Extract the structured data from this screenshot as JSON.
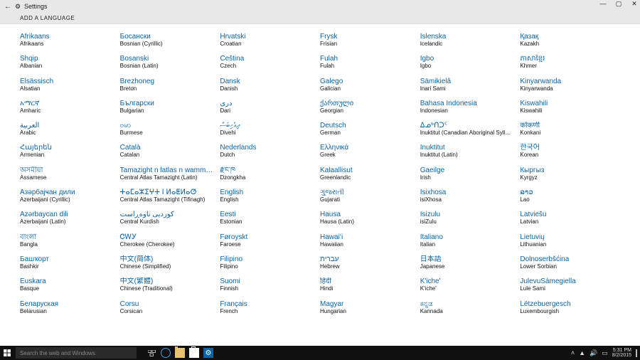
{
  "window": {
    "title": "Settings",
    "page_header": "ADD A LANGUAGE"
  },
  "columns": [
    [
      {
        "native": "Afrikaans",
        "english": "Afrikaans"
      },
      {
        "native": "Shqip",
        "english": "Albanian"
      },
      {
        "native": "Elsässisch",
        "english": "Alsatian"
      },
      {
        "native": "አማርኛ",
        "english": "Amharic"
      },
      {
        "native": "العربية",
        "english": "Arabic"
      },
      {
        "native": "Հայերեն",
        "english": "Armenian"
      },
      {
        "native": "অসমীয়া",
        "english": "Assamese"
      },
      {
        "native": "Азәрбајҹан дили",
        "english": "Azerbaijani (Cyrillic)"
      },
      {
        "native": "Azərbaycan dili",
        "english": "Azerbaijani (Latin)"
      },
      {
        "native": "বাংলা",
        "english": "Bangla"
      },
      {
        "native": "Башҡорт",
        "english": "Bashkir"
      },
      {
        "native": "Euskara",
        "english": "Basque"
      },
      {
        "native": "Беларуская",
        "english": "Belarusian"
      }
    ],
    [
      {
        "native": "Босански",
        "english": "Bosnian (Cyrillic)"
      },
      {
        "native": "Bosanski",
        "english": "Bosnian (Latin)"
      },
      {
        "native": "Brezhoneg",
        "english": "Breton"
      },
      {
        "native": "Български",
        "english": "Bulgarian"
      },
      {
        "native": "ဗမာ",
        "english": "Burmese"
      },
      {
        "native": "Català",
        "english": "Catalan"
      },
      {
        "native": "Tamazight n latlas n wamm…",
        "english": "Central Atlas Tamazight (Latin)"
      },
      {
        "native": "ⵜⴰⵎⴰⵣⵉⵖⵜ ⵏ ⵍⴰⵟⵍⴰⵚ",
        "english": "Central Atlas Tamazight (Tifinagh)"
      },
      {
        "native": "کوردیی ناوەڕاست",
        "english": "Central Kurdish"
      },
      {
        "native": "ᏣᎳᎩ",
        "english": "Cherokee (Cherokee)"
      },
      {
        "native": "中文(简体)",
        "english": "Chinese (Simplified)"
      },
      {
        "native": "中文(繁體)",
        "english": "Chinese (Traditional)"
      },
      {
        "native": "Corsu",
        "english": "Corsican"
      }
    ],
    [
      {
        "native": "Hrvatski",
        "english": "Croatian"
      },
      {
        "native": "Čeština",
        "english": "Czech"
      },
      {
        "native": "Dansk",
        "english": "Danish"
      },
      {
        "native": "درى",
        "english": "Dari"
      },
      {
        "native": "ދިވެހިބަސް",
        "english": "Divehi"
      },
      {
        "native": "Nederlands",
        "english": "Dutch"
      },
      {
        "native": "རྫོང་ཁ",
        "english": "Dzongkha"
      },
      {
        "native": "English",
        "english": "English"
      },
      {
        "native": "Eesti",
        "english": "Estonian"
      },
      {
        "native": "Føroyskt",
        "english": "Faroese"
      },
      {
        "native": "Filipino",
        "english": "Filipino"
      },
      {
        "native": "Suomi",
        "english": "Finnish"
      },
      {
        "native": "Français",
        "english": "French"
      }
    ],
    [
      {
        "native": "Frysk",
        "english": "Frisian"
      },
      {
        "native": "Fulah",
        "english": "Fulah"
      },
      {
        "native": "Galego",
        "english": "Galician"
      },
      {
        "native": "ქართული",
        "english": "Georgian"
      },
      {
        "native": "Deutsch",
        "english": "German"
      },
      {
        "native": "Ελληνικά",
        "english": "Greek"
      },
      {
        "native": "Kalaallisut",
        "english": "Greenlandic"
      },
      {
        "native": "ગુજરાતી",
        "english": "Gujarati"
      },
      {
        "native": "Hausa",
        "english": "Hausa (Latin)"
      },
      {
        "native": "Hawaiʻi",
        "english": "Hawaiian"
      },
      {
        "native": "עברית",
        "english": "Hebrew"
      },
      {
        "native": "हिंदी",
        "english": "Hindi"
      },
      {
        "native": "Magyar",
        "english": "Hungarian"
      }
    ],
    [
      {
        "native": "Íslenska",
        "english": "Icelandic"
      },
      {
        "native": "Igbo",
        "english": "Igbo"
      },
      {
        "native": "Sämikielâ",
        "english": "Inari Sami"
      },
      {
        "native": "Bahasa Indonesia",
        "english": "Indonesian"
      },
      {
        "native": "ᐃᓄᒃᑎᑐᑦ",
        "english": "Inuktitut (Canadian Aboriginal Syllabics)"
      },
      {
        "native": "Inuktitut",
        "english": "Inuktitut (Latin)"
      },
      {
        "native": "Gaeilge",
        "english": "Irish"
      },
      {
        "native": "Isixhosa",
        "english": "isiXhosa"
      },
      {
        "native": "Isizulu",
        "english": "isiZulu"
      },
      {
        "native": "Italiano",
        "english": "Italian"
      },
      {
        "native": "日本語",
        "english": "Japanese"
      },
      {
        "native": "K'iche'",
        "english": "K'iche'"
      },
      {
        "native": "ಕನ್ನಡ",
        "english": "Kannada"
      }
    ],
    [
      {
        "native": "Қазақ",
        "english": "Kazakh"
      },
      {
        "native": "ភាសាខ្មែរ",
        "english": "Khmer"
      },
      {
        "native": "Kinyarwanda",
        "english": "Kinyarwanda"
      },
      {
        "native": "Kiswahili",
        "english": "Kiswahili"
      },
      {
        "native": "कोंकणी",
        "english": "Konkani"
      },
      {
        "native": "한국어",
        "english": "Korean"
      },
      {
        "native": "Кыргыз",
        "english": "Kyrgyz"
      },
      {
        "native": "ລາວ",
        "english": "Lao"
      },
      {
        "native": "Latviešu",
        "english": "Latvian"
      },
      {
        "native": "Lietuvių",
        "english": "Lithuanian"
      },
      {
        "native": "Dolnoserbšćina",
        "english": "Lower Sorbian"
      },
      {
        "native": "JulevuSámegiella",
        "english": "Lule Sami"
      },
      {
        "native": "Lëtzebuergesch",
        "english": "Luxembourgish"
      }
    ]
  ],
  "taskbar": {
    "search_placeholder": "Search the web and Windows",
    "time": "5:31 PM",
    "date": "8/2/2015"
  }
}
